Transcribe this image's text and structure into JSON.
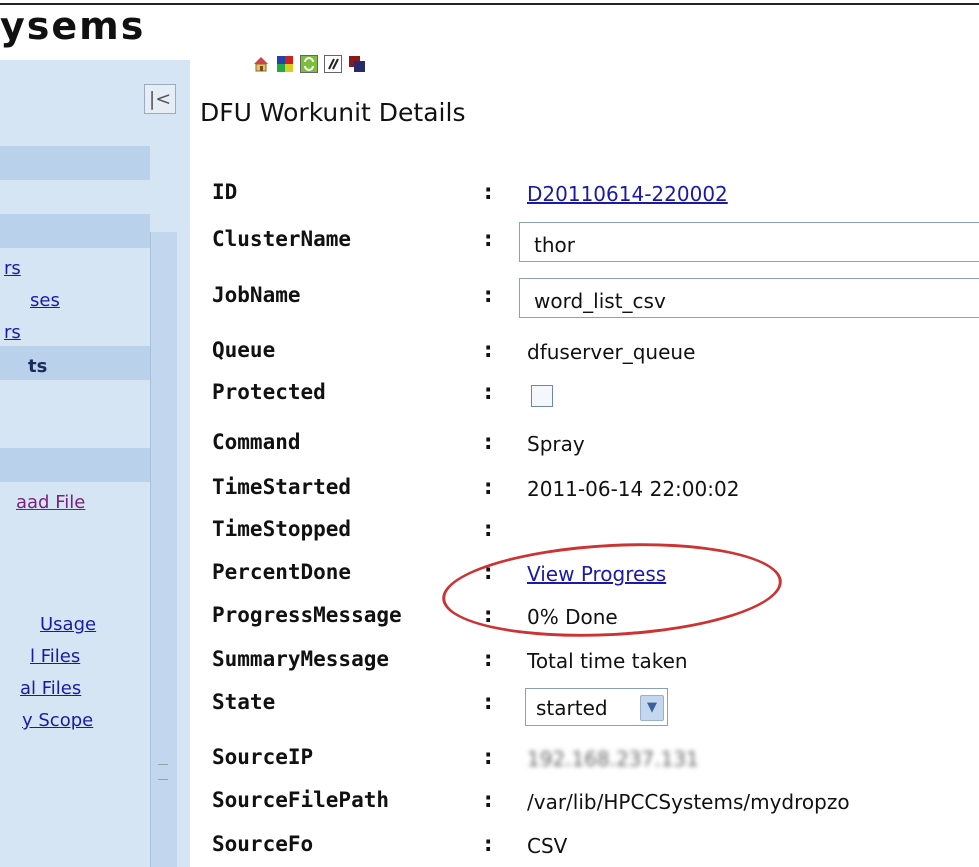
{
  "logo_text": "ysems",
  "toolbar": {
    "icons": [
      "home-icon",
      "color-grid-icon",
      "refresh-icon",
      "pencil-icon",
      "dual-window-icon"
    ]
  },
  "sidebar": {
    "collapse_label": "|<",
    "links": [
      {
        "label": "rs",
        "visited": false,
        "bold": false
      },
      {
        "label": "ses",
        "visited": false,
        "bold": false
      },
      {
        "label": "rs",
        "visited": false,
        "bold": false
      },
      {
        "label": "ts",
        "visited": false,
        "bold": true
      },
      {
        "label": "aad File",
        "visited": true,
        "bold": false
      },
      {
        "label": "Usage",
        "visited": false,
        "bold": false
      },
      {
        "label": "l Files",
        "visited": false,
        "bold": false
      },
      {
        "label": "al Files",
        "visited": false,
        "bold": false
      },
      {
        "label": "y Scope",
        "visited": false,
        "bold": false
      }
    ]
  },
  "page_title": "DFU Workunit Details",
  "fields": {
    "id": {
      "label": "ID",
      "value": "D20110614-220002"
    },
    "cluster": {
      "label": "ClusterName",
      "value": "thor"
    },
    "job": {
      "label": "JobName",
      "value": "word_list_csv"
    },
    "queue": {
      "label": "Queue",
      "value": "dfuserver_queue"
    },
    "protected": {
      "label": "Protected",
      "checked": false
    },
    "command": {
      "label": "Command",
      "value": "Spray"
    },
    "started": {
      "label": "TimeStarted",
      "value": "2011-06-14 22:00:02"
    },
    "stopped": {
      "label": "TimeStopped",
      "value": ""
    },
    "percent": {
      "label": "PercentDone",
      "value": "View Progress"
    },
    "progress": {
      "label": "ProgressMessage",
      "value": "0% Done"
    },
    "summary": {
      "label": "SummaryMessage",
      "value": "Total time taken"
    },
    "state": {
      "label": "State",
      "value": "started"
    },
    "source_ip": {
      "label": "SourceIP",
      "value": "192.168.237.131"
    },
    "source_path": {
      "label": "SourceFilePath",
      "value": "/var/lib/HPCCSystems/mydropzo"
    },
    "source_fmt": {
      "label": "SourceFo",
      "value": "CSV"
    }
  },
  "colon": ":",
  "colors": {
    "link": "#1a1aa6",
    "highlight_ellipse": "#cc3333",
    "sidebar_bg": "#d6e5f4"
  }
}
